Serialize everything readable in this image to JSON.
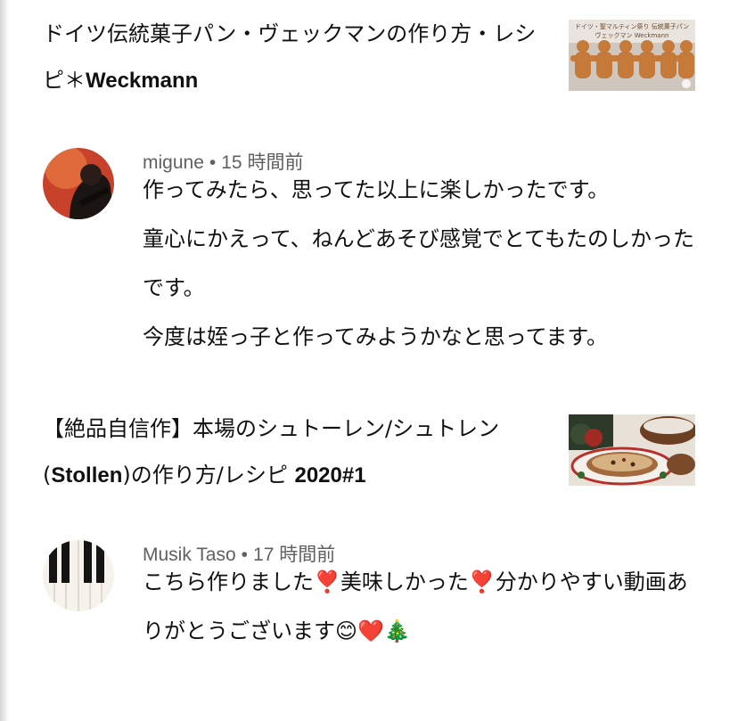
{
  "items": [
    {
      "video_title_plain": "ドイツ伝統菓子パン・ヴェックマンの作り方・レシピ＊",
      "video_title_bold": "Weckmann",
      "thumb_text_1": "ドイツ・聖マルティン祭り 伝統菓子パン",
      "thumb_text_2": "ヴェックマン Weckmann"
    },
    {
      "author": "migune",
      "dot": "•",
      "time": "15 時間前",
      "lines": [
        "作ってみたら、思ってた以上に楽しかったです。",
        "童心にかえって、ねんどあそび感覚でとてもたのしかったです。",
        "今度は姪っ子と作ってみようかなと思ってます。"
      ]
    },
    {
      "video_title_part1": "【絶品自信作】本場のシュトーレン/シュトレン(",
      "video_title_bold1": "Stollen",
      "video_title_part2": ")の作り方/レシピ ",
      "video_title_bold2": "2020#1"
    },
    {
      "author": "Musik Taso",
      "dot": "•",
      "time": "17 時間前",
      "text_1": "こちら作りました",
      "emoji_1": "❣️",
      "text_2": "美味しかった",
      "emoji_2": "❣️",
      "text_3": "分かりやすい動画ありがとうございます",
      "emoji_3": "😊",
      "emoji_4": "❤️",
      "emoji_5": "🎄"
    }
  ]
}
